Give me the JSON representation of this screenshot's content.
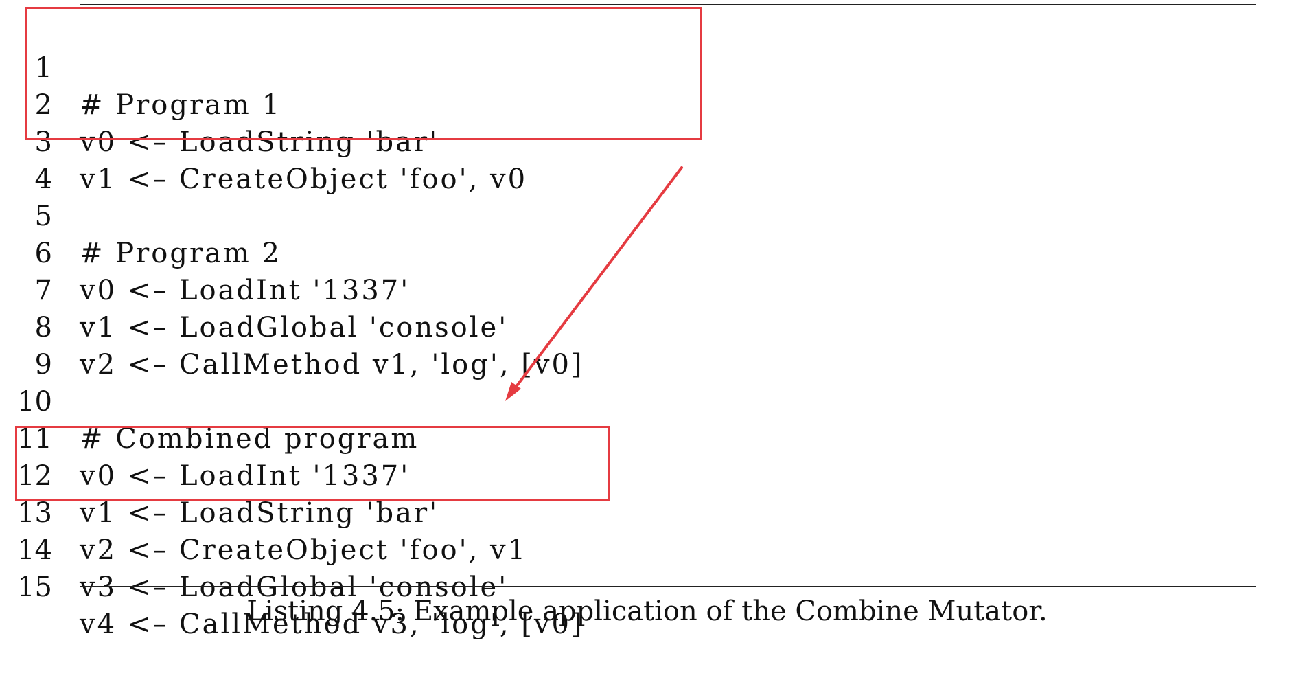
{
  "listing": {
    "lines": [
      {
        "no": "1",
        "code": "# Program 1"
      },
      {
        "no": "2",
        "code": "v0 <– LoadString 'bar'"
      },
      {
        "no": "3",
        "code": "v1 <– CreateObject 'foo', v0"
      },
      {
        "no": "4",
        "code": ""
      },
      {
        "no": "5",
        "code": "# Program 2"
      },
      {
        "no": "6",
        "code": "v0 <– LoadInt '1337'"
      },
      {
        "no": "7",
        "code": "v1 <– LoadGlobal 'console'"
      },
      {
        "no": "8",
        "code": "v2 <– CallMethod v1, 'log', [v0]"
      },
      {
        "no": "9",
        "code": ""
      },
      {
        "no": "10",
        "code": "# Combined program"
      },
      {
        "no": "11",
        "code": "v0 <– LoadInt '1337'"
      },
      {
        "no": "12",
        "code": "v1 <– LoadString 'bar'"
      },
      {
        "no": "13",
        "code": "v2 <– CreateObject 'foo', v1"
      },
      {
        "no": "14",
        "code": "v3 <– LoadGlobal 'console'"
      },
      {
        "no": "15",
        "code": "v4 <– CallMethod v3, 'log', [v0]"
      }
    ]
  },
  "caption": "Listing 4.5: Example application of the Combine Mutator.",
  "colors": {
    "highlight": "#e53b41",
    "text": "#111111",
    "rule": "#222222"
  }
}
